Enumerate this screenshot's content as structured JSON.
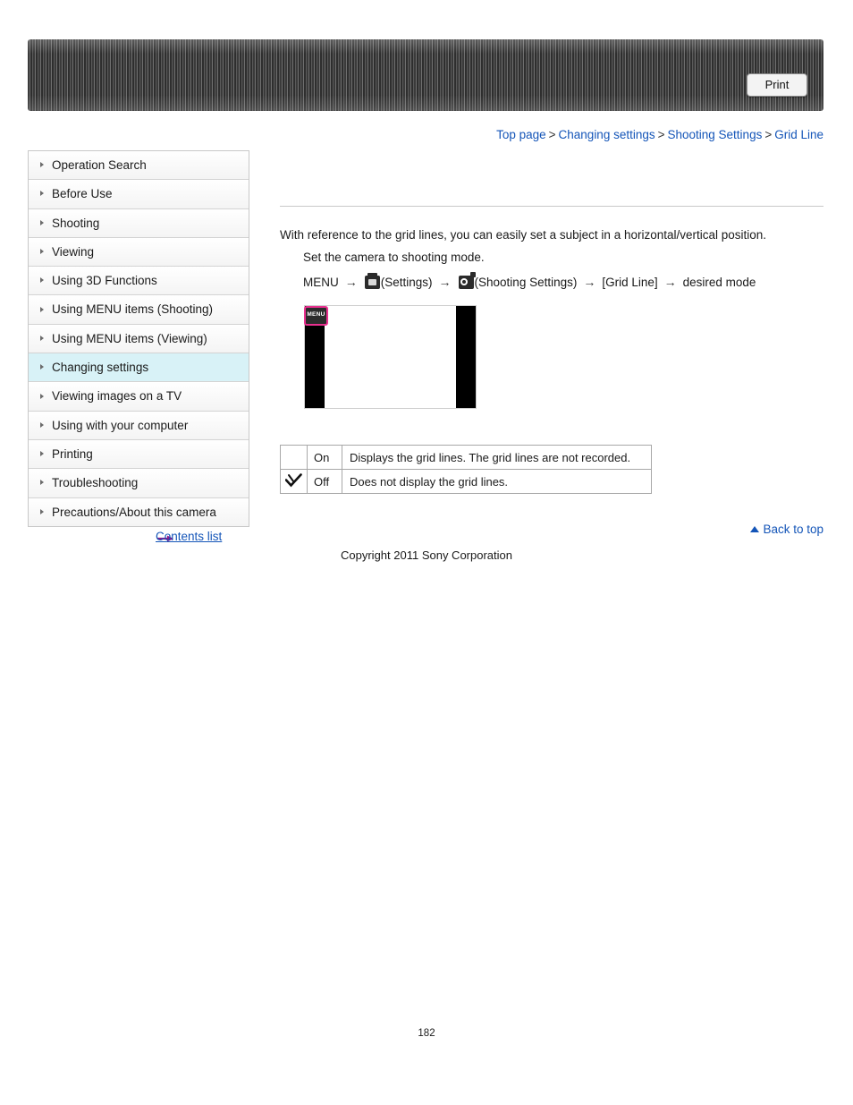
{
  "header": {
    "print_label": "Print"
  },
  "breadcrumb": {
    "items": [
      "Top page",
      "Changing settings",
      "Shooting Settings",
      "Grid Line"
    ],
    "separator": ">"
  },
  "sidebar": {
    "items": [
      {
        "label": "Operation Search"
      },
      {
        "label": "Before Use"
      },
      {
        "label": "Shooting"
      },
      {
        "label": "Viewing"
      },
      {
        "label": "Using 3D Functions"
      },
      {
        "label": "Using MENU items (Shooting)"
      },
      {
        "label": "Using MENU items (Viewing)"
      },
      {
        "label": "Changing settings"
      },
      {
        "label": "Viewing images on a TV"
      },
      {
        "label": "Using with your computer"
      },
      {
        "label": "Printing"
      },
      {
        "label": "Troubleshooting"
      },
      {
        "label": "Precautions/About this camera"
      }
    ],
    "contents_list_label": "Contents list"
  },
  "main": {
    "intro": "With reference to the grid lines, you can easily set a subject in a horizontal/vertical position.",
    "step1": "Set the camera to shooting mode.",
    "menu_path": {
      "start": "MENU",
      "settings_label": "(Settings)",
      "shooting_settings_label": "(Shooting Settings)",
      "item_label": "[Grid Line]",
      "end_label": "desired mode",
      "arrow": "→"
    },
    "screen_illustration": {
      "menu_badge_text": "MENU"
    },
    "options": [
      {
        "mark": "",
        "name": "On",
        "description": "Displays the grid lines. The grid lines are not recorded."
      },
      {
        "mark": "check",
        "name": "Off",
        "description": "Does not display the grid lines."
      }
    ]
  },
  "footer": {
    "back_to_top": "Back to top",
    "copyright": "Copyright 2011 Sony Corporation",
    "page_number": "182"
  }
}
